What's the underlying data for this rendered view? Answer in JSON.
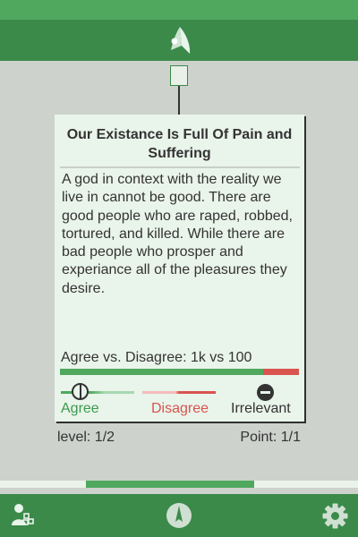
{
  "header": {
    "logo_icon": "rocket-logo-icon",
    "accent_color": "#3b8a4a",
    "status_color": "#4fa85d"
  },
  "card": {
    "title": "Our Existance Is Full Of Pain and Suffering",
    "body": "A god in context with the reality we live in cannot be good. There are good people who are raped, robbed, tortured, and killed. While there are bad people who prosper and experiance all of the pleasures they desire.",
    "tally_text": "Agree vs. Disagree: 1k vs 100",
    "agree_share": 0.85,
    "agree_color": "#4fa85d",
    "disagree_color": "#d9534f"
  },
  "votes": {
    "agree_label": "Agree",
    "disagree_label": "Disagree",
    "irrelevant_label": "Irrelevant"
  },
  "progress": {
    "level_text": "level: 1/2",
    "point_text": "Point: 1/1",
    "segment_start": 0.24,
    "segment_end": 0.71
  },
  "bottom_nav": {
    "items": [
      {
        "icon": "profile-icon"
      },
      {
        "icon": "compass-icon"
      },
      {
        "icon": "settings-icon"
      }
    ]
  }
}
